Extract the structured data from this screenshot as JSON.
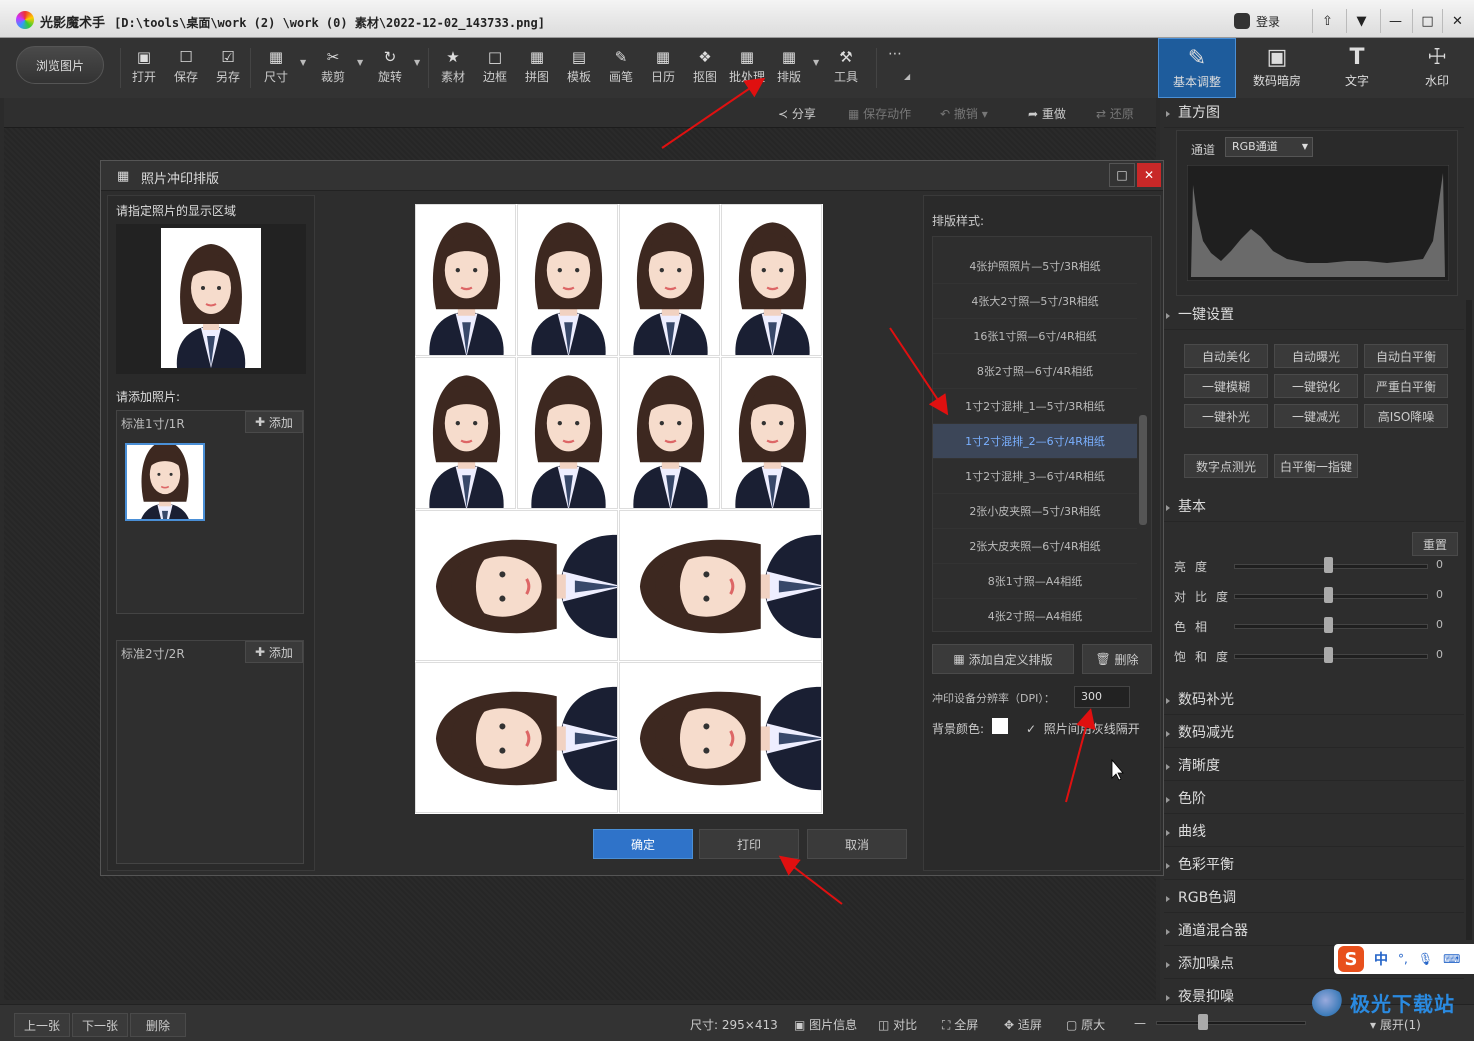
{
  "window": {
    "app_name": "光影魔术手",
    "file_path": "[D:\\tools\\桌面\\work (2) \\work (0) 素材\\2022-12-02_143733.png]",
    "login": "登录"
  },
  "toolbar": {
    "browse": "浏览图片",
    "tools": [
      "打开",
      "保存",
      "另存",
      "尺寸",
      "裁剪",
      "旋转",
      "素材",
      "边框",
      "拼图",
      "模板",
      "画笔",
      "日历",
      "抠图",
      "批处理",
      "排版",
      "工具"
    ]
  },
  "right_tabs": [
    "基本调整",
    "数码暗房",
    "文字",
    "水印"
  ],
  "subbar": {
    "share": "分享",
    "save_action": "保存动作",
    "undo": "撤销",
    "redo": "重做",
    "restore": "还原"
  },
  "histogram": {
    "title": "直方图",
    "channel_label": "通道",
    "channel_value": "RGB通道"
  },
  "oneclick": {
    "title": "一键设置",
    "buttons": [
      "自动美化",
      "自动曝光",
      "自动白平衡",
      "一键模糊",
      "一键锐化",
      "严重白平衡",
      "一键补光",
      "一键减光",
      "高ISO降噪",
      "数字点测光",
      "白平衡一指键"
    ]
  },
  "basic": {
    "title": "基本",
    "reset": "重置",
    "sliders": [
      {
        "label": "亮度",
        "value": "0"
      },
      {
        "label": "对比度",
        "value": "0"
      },
      {
        "label": "色相",
        "value": "0"
      },
      {
        "label": "饱和度",
        "value": "0"
      }
    ]
  },
  "sections": [
    "数码补光",
    "数码减光",
    "清晰度",
    "色阶",
    "曲线",
    "色彩平衡",
    "RGB色调",
    "通道混合器",
    "添加噪点",
    "夜景抑噪"
  ],
  "dialog": {
    "title": "照片冲印排版",
    "display_area": "请指定照片的显示区域",
    "add_photos": "请添加照片:",
    "slot1": "标准1寸/1R",
    "slot2": "标准2寸/2R",
    "add": "添加",
    "layout_style": "排版样式:",
    "layouts": [
      "4张护照照片—5寸/3R相纸",
      "4张大2寸照—5寸/3R相纸",
      "16张1寸照—6寸/4R相纸",
      "8张2寸照—6寸/4R相纸",
      "1寸2寸混排_1—5寸/3R相纸",
      "1寸2寸混排_2—6寸/4R相纸",
      "1寸2寸混排_3—6寸/4R相纸",
      "2张小皮夹照—5寸/3R相纸",
      "2张大皮夹照—6寸/4R相纸",
      "8张1寸照—A4相纸",
      "4张2寸照—A4相纸"
    ],
    "add_custom": "添加自定义排版",
    "delete": "删除",
    "dpi_label": "冲印设备分辨率（DPI）：",
    "dpi_value": "300",
    "bg_label": "背景颜色:",
    "gap_label": "照片间用灰线隔开",
    "ok": "确定",
    "print": "打印",
    "cancel": "取消"
  },
  "status": {
    "prev": "上一张",
    "next": "下一张",
    "delete": "删除",
    "size": "尺寸: 295×413",
    "info": "图片信息",
    "compare": "对比",
    "fullscreen": "全屏",
    "fit": "适屏",
    "original": "原大",
    "expand": "展开(1)"
  },
  "ime": {
    "lang": "中"
  },
  "watermark": "极光下载站",
  "colors": {
    "accent": "#1e5c9c",
    "ok_button": "#2f73c9",
    "arrow": "#e01010",
    "close": "#c82828"
  }
}
